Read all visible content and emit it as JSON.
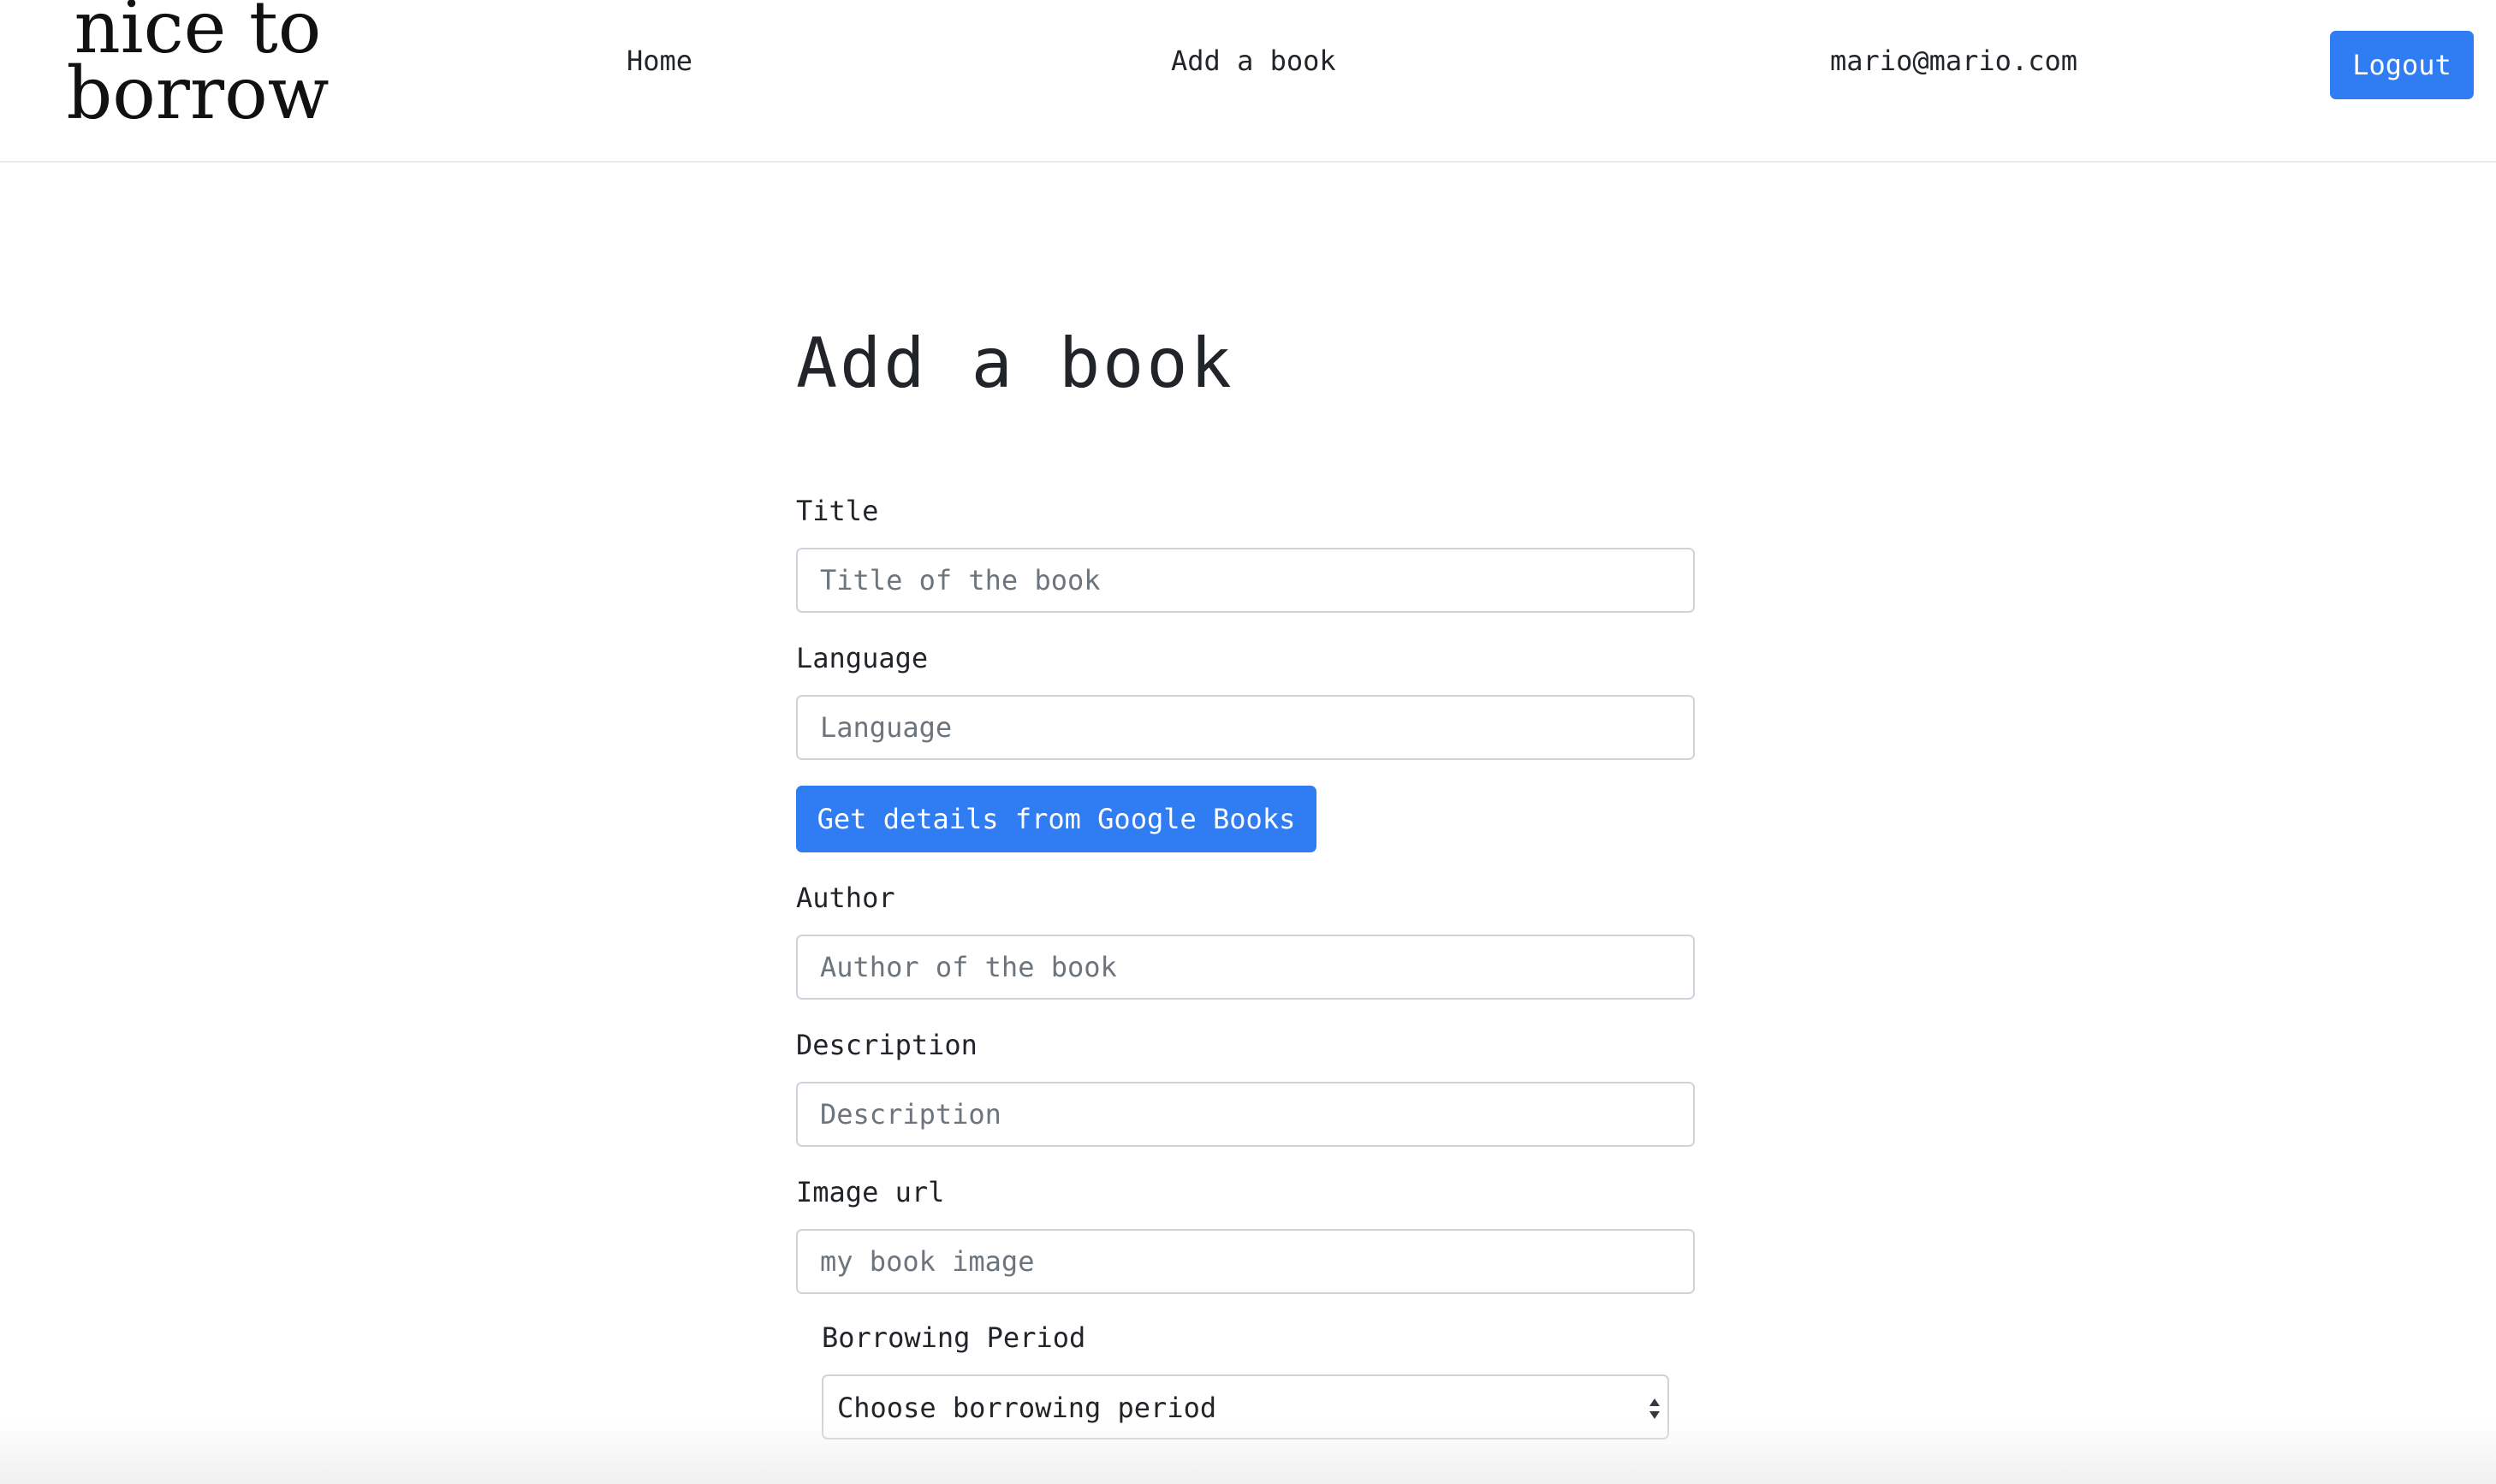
{
  "brand": {
    "line1": "nice to",
    "line2": "borrow"
  },
  "nav": {
    "home": "Home",
    "add_book": "Add a book",
    "user_email": "mario@mario.com",
    "logout": "Logout"
  },
  "form": {
    "heading": "Add a book",
    "title": {
      "label": "Title",
      "placeholder": "Title of the book",
      "value": ""
    },
    "language": {
      "label": "Language",
      "placeholder": "Language",
      "value": ""
    },
    "google_button": "Get details from Google Books",
    "author": {
      "label": "Author",
      "placeholder": "Author of the book",
      "value": ""
    },
    "description": {
      "label": "Description",
      "placeholder": "Description",
      "value": ""
    },
    "image_url": {
      "label": "Image url",
      "placeholder": "my book image",
      "value": ""
    },
    "borrowing_period": {
      "label": "Borrowing Period",
      "selected": "Choose borrowing period"
    }
  },
  "colors": {
    "accent": "#2f7cf3",
    "border": "#cfd4da",
    "placeholder": "#6c757d",
    "text": "#212529"
  }
}
